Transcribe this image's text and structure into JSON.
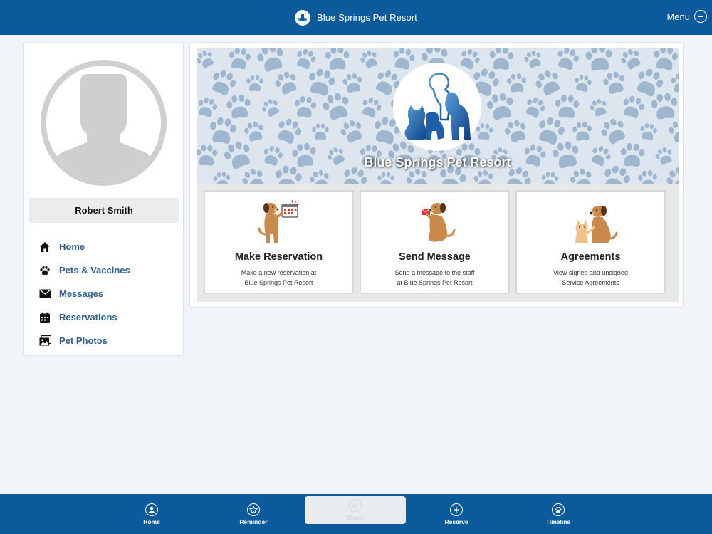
{
  "header": {
    "brand_name": "Blue Springs Pet Resort",
    "menu_label": "Menu"
  },
  "user": {
    "name": "Robert Smith"
  },
  "sidebar": {
    "items": [
      {
        "label": "Home",
        "icon": "home-icon"
      },
      {
        "label": "Pets & Vaccines",
        "icon": "paw-icon"
      },
      {
        "label": "Messages",
        "icon": "envelope-icon"
      },
      {
        "label": "Reservations",
        "icon": "calendar-icon"
      },
      {
        "label": "Pet Photos",
        "icon": "photos-icon"
      }
    ]
  },
  "hero": {
    "title": "Blue Springs Pet Resort"
  },
  "cards": [
    {
      "title": "Make Reservation",
      "desc_line1": "Make a new reservation at",
      "desc_line2": "Blue Springs Pet Resort"
    },
    {
      "title": "Send Message",
      "desc_line1": "Send a message to the staff",
      "desc_line2": "at Blue Springs Pet Resort"
    },
    {
      "title": "Agreements",
      "desc_line1": "View signed and unsigned",
      "desc_line2": "Service Agreements"
    }
  ],
  "bottom_tabs": [
    {
      "label": "Home",
      "icon": "user-icon"
    },
    {
      "label": "Reminder",
      "icon": "star-icon"
    },
    {
      "label": "Share",
      "icon": "share-icon"
    },
    {
      "label": "Reserve",
      "icon": "plus-icon"
    },
    {
      "label": "Timeline",
      "icon": "paw-icon"
    }
  ],
  "colors": {
    "brand": "#0a5a9c",
    "nav_link": "#2e5f91",
    "background": "#f1f4f8"
  }
}
